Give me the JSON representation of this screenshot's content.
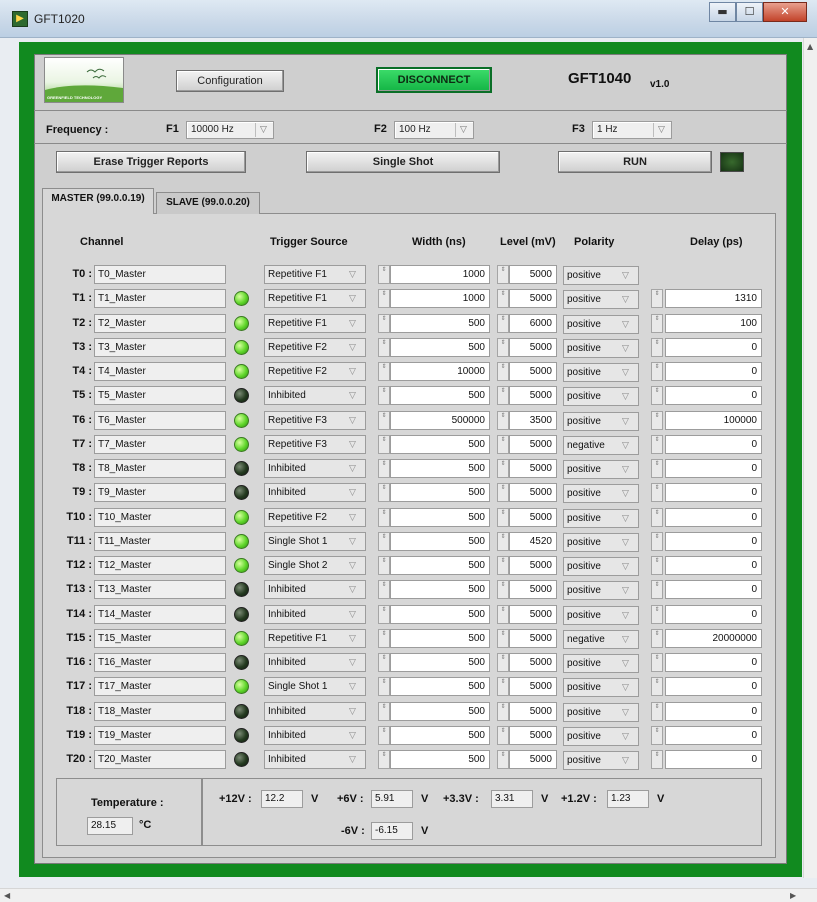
{
  "window": {
    "title": "GFT1020",
    "min_glyph": "▬",
    "max_glyph": "☐",
    "close_glyph": "✕"
  },
  "header": {
    "logo_text": "GREENFIELD TECHNOLOGY",
    "config_label": "Configuration",
    "disconnect_label": "DISCONNECT",
    "device": "GFT1040",
    "version": "v1.0"
  },
  "frequency": {
    "label": "Frequency :",
    "f1_label": "F1",
    "f1_value": "10000 Hz",
    "f2_label": "F2",
    "f2_value": "100 Hz",
    "f3_label": "F3",
    "f3_value": "1 Hz"
  },
  "actions": {
    "erase": "Erase Trigger Reports",
    "single": "Single Shot",
    "run": "RUN"
  },
  "tabs": {
    "master": "MASTER (99.0.0.19)",
    "slave": "SLAVE (99.0.0.20)"
  },
  "columns": {
    "channel": "Channel",
    "trigger": "Trigger Source",
    "width": "Width (ns)",
    "level": "Level (mV)",
    "polarity": "Polarity",
    "delay": "Delay (ps)"
  },
  "channels": [
    {
      "label": "T0 :",
      "name": "T0_Master",
      "led": "none",
      "trigger": "Repetitive F1",
      "width": "1000",
      "level": "5000",
      "polarity": "positive",
      "delay": ""
    },
    {
      "label": "T1 :",
      "name": "T1_Master",
      "led": "on",
      "trigger": "Repetitive F1",
      "width": "1000",
      "level": "5000",
      "polarity": "positive",
      "delay": "1310"
    },
    {
      "label": "T2 :",
      "name": "T2_Master",
      "led": "on",
      "trigger": "Repetitive F1",
      "width": "500",
      "level": "6000",
      "polarity": "positive",
      "delay": "100"
    },
    {
      "label": "T3 :",
      "name": "T3_Master",
      "led": "on",
      "trigger": "Repetitive F2",
      "width": "500",
      "level": "5000",
      "polarity": "positive",
      "delay": "0"
    },
    {
      "label": "T4 :",
      "name": "T4_Master",
      "led": "on",
      "trigger": "Repetitive F2",
      "width": "10000",
      "level": "5000",
      "polarity": "positive",
      "delay": "0"
    },
    {
      "label": "T5 :",
      "name": "T5_Master",
      "led": "off",
      "trigger": "Inhibited",
      "width": "500",
      "level": "5000",
      "polarity": "positive",
      "delay": "0"
    },
    {
      "label": "T6 :",
      "name": "T6_Master",
      "led": "on",
      "trigger": "Repetitive F3",
      "width": "500000",
      "level": "3500",
      "polarity": "positive",
      "delay": "100000"
    },
    {
      "label": "T7 :",
      "name": "T7_Master",
      "led": "on",
      "trigger": "Repetitive F3",
      "width": "500",
      "level": "5000",
      "polarity": "negative",
      "delay": "0"
    },
    {
      "label": "T8 :",
      "name": "T8_Master",
      "led": "off",
      "trigger": "Inhibited",
      "width": "500",
      "level": "5000",
      "polarity": "positive",
      "delay": "0"
    },
    {
      "label": "T9 :",
      "name": "T9_Master",
      "led": "off",
      "trigger": "Inhibited",
      "width": "500",
      "level": "5000",
      "polarity": "positive",
      "delay": "0"
    },
    {
      "label": "T10 :",
      "name": "T10_Master",
      "led": "on",
      "trigger": "Repetitive F2",
      "width": "500",
      "level": "5000",
      "polarity": "positive",
      "delay": "0"
    },
    {
      "label": "T11 :",
      "name": "T11_Master",
      "led": "on",
      "trigger": "Single Shot 1",
      "width": "500",
      "level": "4520",
      "polarity": "positive",
      "delay": "0"
    },
    {
      "label": "T12 :",
      "name": "T12_Master",
      "led": "on",
      "trigger": "Single Shot 2",
      "width": "500",
      "level": "5000",
      "polarity": "positive",
      "delay": "0"
    },
    {
      "label": "T13 :",
      "name": "T13_Master",
      "led": "off",
      "trigger": "Inhibited",
      "width": "500",
      "level": "5000",
      "polarity": "positive",
      "delay": "0"
    },
    {
      "label": "T14 :",
      "name": "T14_Master",
      "led": "off",
      "trigger": "Inhibited",
      "width": "500",
      "level": "5000",
      "polarity": "positive",
      "delay": "0"
    },
    {
      "label": "T15 :",
      "name": "T15_Master",
      "led": "on",
      "trigger": "Repetitive F1",
      "width": "500",
      "level": "5000",
      "polarity": "negative",
      "delay": "20000000"
    },
    {
      "label": "T16 :",
      "name": "T16_Master",
      "led": "off",
      "trigger": "Inhibited",
      "width": "500",
      "level": "5000",
      "polarity": "positive",
      "delay": "0"
    },
    {
      "label": "T17 :",
      "name": "T17_Master",
      "led": "on",
      "trigger": "Single Shot 1",
      "width": "500",
      "level": "5000",
      "polarity": "positive",
      "delay": "0"
    },
    {
      "label": "T18 :",
      "name": "T18_Master",
      "led": "off",
      "trigger": "Inhibited",
      "width": "500",
      "level": "5000",
      "polarity": "positive",
      "delay": "0"
    },
    {
      "label": "T19 :",
      "name": "T19_Master",
      "led": "off",
      "trigger": "Inhibited",
      "width": "500",
      "level": "5000",
      "polarity": "positive",
      "delay": "0"
    },
    {
      "label": "T20 :",
      "name": "T20_Master",
      "led": "off",
      "trigger": "Inhibited",
      "width": "500",
      "level": "5000",
      "polarity": "positive",
      "delay": "0"
    }
  ],
  "temperature": {
    "label": "Temperature :",
    "value": "28.15",
    "unit": "°C"
  },
  "voltages": {
    "p12_label": "+12V :",
    "p12_value": "12.2",
    "p6_label": "+6V :",
    "p6_value": "5.91",
    "p33_label": "+3.3V :",
    "p33_value": "3.31",
    "p12b_label": "+1.2V :",
    "p12b_value": "1.23",
    "n6_label": "-6V :",
    "n6_value": "-6.15",
    "unit": "V"
  },
  "icons": {
    "dropdown": "▽",
    "spin": "⇕"
  },
  "colors": {
    "frame_green": "#118a1f",
    "led_on": "#5fd62a",
    "led_off": "#243a20",
    "disconnect": "#14b545"
  }
}
